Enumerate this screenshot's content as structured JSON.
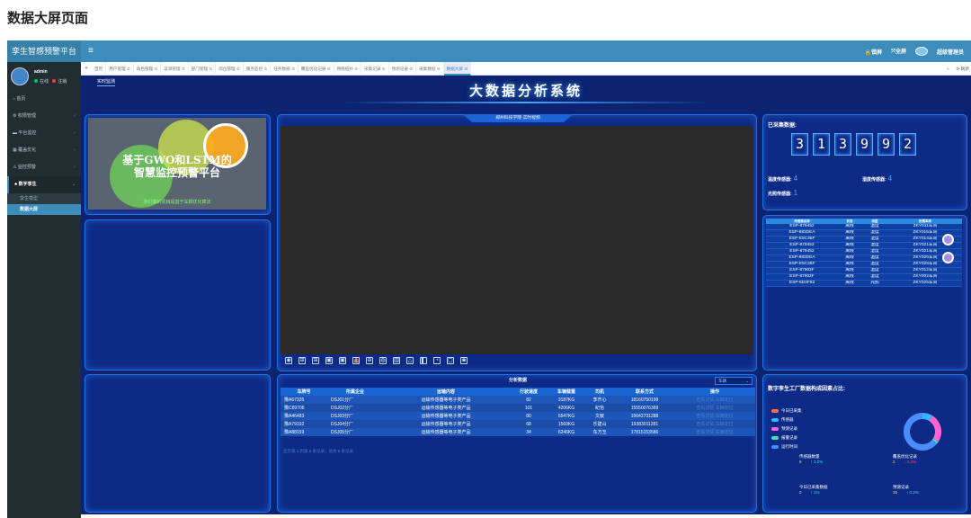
{
  "page_heading": "数据大屏页面",
  "app": {
    "title": "孪生智感预警平台",
    "menu_toggle": "≡"
  },
  "topbar": {
    "lock": "🔒锁屏",
    "fullscreen": "⤧全屏",
    "admin_name": "超级管理员"
  },
  "user": {
    "name": "admin",
    "online": "在线",
    "logout": "注销"
  },
  "sidebar": {
    "items": [
      {
        "label": "首页",
        "icon": "home-icon",
        "glyph": "⌂",
        "chev": ""
      },
      {
        "label": "权限管理",
        "icon": "gear-icon",
        "glyph": "⚙",
        "chev": "‹"
      },
      {
        "label": "平台监控",
        "icon": "monitor-icon",
        "glyph": "▬",
        "chev": "‹"
      },
      {
        "label": "覆盖优化",
        "icon": "grid-icon",
        "glyph": "▦",
        "chev": "‹"
      },
      {
        "label": "监控预警",
        "icon": "alert-icon",
        "glyph": "⚠",
        "chev": "‹"
      },
      {
        "label": "数字孪生",
        "icon": "digital-twin-icon",
        "glyph": "♣",
        "chev": "⌄"
      }
    ],
    "sub_items": [
      {
        "label": "孪生模型"
      },
      {
        "label": "数据大屏"
      }
    ]
  },
  "tabs": {
    "prev": "«",
    "next": "»",
    "refresh": "⟳ 刷新",
    "items": [
      {
        "label": "首页"
      },
      {
        "label": "用户管理 ⊙"
      },
      {
        "label": "角色管理 ⊙"
      },
      {
        "label": "菜单管理 ⊙"
      },
      {
        "label": "部门管理 ⊙"
      },
      {
        "label": "岗位管理 ⊙"
      },
      {
        "label": "服务监控 ⊙"
      },
      {
        "label": "任务数据 ⊙"
      },
      {
        "label": "覆盖优化记录 ⊙"
      },
      {
        "label": "网络拓扑 ⊙"
      },
      {
        "label": "采集记录 ⊙"
      },
      {
        "label": "预测记录 ⊙"
      },
      {
        "label": "采集数据 ⊙"
      },
      {
        "label": "数据大屏 ⊙"
      }
    ]
  },
  "dashboard": {
    "subtab": "实时监测",
    "title": "大数据分析系统",
    "banner": {
      "line1": "基于GWO和LSTM的",
      "line2": "智慧监控预警平台",
      "caption": "我们做的项目是基于车脚优化算法"
    },
    "video_header": "郑州科技学院-实时视频",
    "video_tools": [
      "◉",
      "⊞",
      "⊞",
      "▣",
      "▣",
      "⛵",
      "⊕",
      "◍",
      "▥",
      "△",
      "▌",
      "◔",
      "▢",
      "◙"
    ]
  },
  "counter": {
    "title": "已采集数据:",
    "digits": [
      "3",
      "1",
      "3",
      "9",
      "9",
      "2"
    ],
    "temp_label": "温度传感器:",
    "temp_value": "4",
    "humid_label": "湿度传感器:",
    "humid_value": "4",
    "light_label": "光照传感器:",
    "light_value": "1"
  },
  "devices": {
    "headers": [
      "传感器名称",
      "状态",
      "类型",
      "所属车间"
    ],
    "rows": [
      [
        "ESP-879452",
        "离线",
        "温度",
        "ZKY011车间"
      ],
      [
        "ESP-883DEA",
        "离线",
        "湿度",
        "ZKY015车间"
      ],
      [
        "ESP-E5C35F",
        "离线",
        "湿度",
        "ZKY014车间"
      ],
      [
        "ESP-879452",
        "离线",
        "温度",
        "ZKY021车间"
      ],
      [
        "ESP-879452",
        "离线",
        "湿度",
        "ZKY021车间"
      ],
      [
        "ESP-883DEA",
        "离线",
        "温度",
        "ZKY026车间"
      ],
      [
        "ESP-E5C35F",
        "离线",
        "温度",
        "ZKY028车间"
      ],
      [
        "ESP-87902F",
        "离线",
        "温度",
        "ZKY012车间"
      ],
      [
        "ESP-87902F",
        "离线",
        "湿度",
        "ZKY002车间"
      ],
      [
        "ESP-8D4F82",
        "离线",
        "光照",
        "ZKY025车间"
      ]
    ]
  },
  "analysis": {
    "title": "分析数据",
    "select": "车辆",
    "headers": [
      "车牌号",
      "所属企业",
      "运输内容",
      "行驶速度",
      "车辆载重",
      "司机",
      "联系方式",
      "操作"
    ],
    "rows": [
      [
        "豫A67335",
        "DSJ01分厂",
        "运输传感器等电子类产品",
        "82",
        "3187KG",
        "李齐心",
        "18160750199",
        "查看详情 车辆定位"
      ],
      [
        "豫C89706",
        "DSJ02分厂",
        "运输传感器等电子类产品",
        "101",
        "4206KG",
        "纪怡",
        "15550076369",
        "查看详情 车辆定位"
      ],
      [
        "豫A46483",
        "DSJ03分厂",
        "运输传感器等电子类产品",
        "80",
        "6547KG",
        "文敏",
        "15642731288",
        "查看详情 车辆定位"
      ],
      [
        "豫A79192",
        "DSJ04分厂",
        "运输传感器等电子类产品",
        "68",
        "1569KG",
        "乐建山",
        "19383011281",
        "查看详情 车辆定位"
      ],
      [
        "豫A88159",
        "DSJ05分厂",
        "运输传感器等电子类产品",
        "34",
        "6246KG",
        "东方玉",
        "17815153586",
        "查看详情 车辆定位"
      ]
    ],
    "footer": "显示第 1 到第 5 条记录，总共 5 条记录"
  },
  "factory": {
    "title": "数字孪生工厂数据构成因素占比:",
    "legend": [
      {
        "label": "今日已采集",
        "color": "#ff6f4f"
      },
      {
        "label": "传感器",
        "color": "#35b4ff"
      },
      {
        "label": "预测记录",
        "color": "#ff64d2"
      },
      {
        "label": "报警记录",
        "color": "#3fe1a6"
      },
      {
        "label": "运行时间",
        "color": "#4a8dff"
      }
    ],
    "stats": [
      {
        "label": "传感器数量",
        "value": "9",
        "change": "↑ 1.2%",
        "dir": "up"
      },
      {
        "label": "覆盖优化记录",
        "value": "2",
        "change": "↓ 0.3%",
        "dir": "down"
      },
      {
        "label": "今日已采集数据",
        "value": "0",
        "change": "↑ 1%",
        "dir": "up"
      },
      {
        "label": "预测记录",
        "value": "25",
        "change": "↑ 0.3%",
        "dir": "up"
      }
    ],
    "chart_data": {
      "type": "pie",
      "title": "数字孪生工厂数据构成因素占比:",
      "categories": [
        "今日已采集",
        "传感器",
        "预测记录",
        "报警记录",
        "运行时间"
      ],
      "values": [
        0,
        9,
        25,
        2,
        64
      ],
      "colors": [
        "#ff6f4f",
        "#35b4ff",
        "#ff64d2",
        "#3fe1a6",
        "#4a8dff"
      ]
    }
  }
}
